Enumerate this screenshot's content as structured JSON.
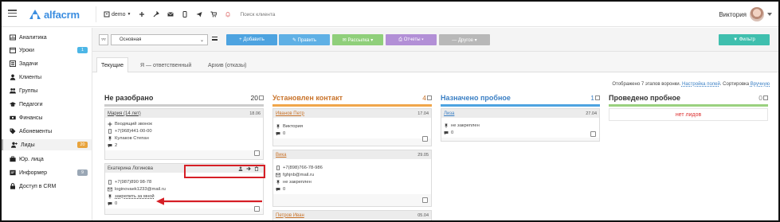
{
  "app": {
    "logo_text": "alfacrm",
    "brand_color": "#3a8de0"
  },
  "topbar": {
    "branch": "demo",
    "search_placeholder": "Поиск клиента",
    "user_name": "Виктория",
    "icons": [
      "plus-icon",
      "wrench-icon",
      "mail-icon",
      "phone-icon",
      "send-icon",
      "cart-icon",
      "bell-icon"
    ]
  },
  "sidebar": {
    "items": [
      {
        "label": "Аналитика",
        "icon": "chart-icon"
      },
      {
        "label": "Уроки",
        "icon": "calendar-icon",
        "badge": "1",
        "badge_color": "#4cb6e6"
      },
      {
        "label": "Задачи",
        "icon": "list-icon"
      },
      {
        "label": "Клиенты",
        "icon": "user-icon"
      },
      {
        "label": "Группы",
        "icon": "users-icon"
      },
      {
        "label": "Педагоги",
        "icon": "graduation-icon"
      },
      {
        "label": "Финансы",
        "icon": "money-icon"
      },
      {
        "label": "Абонементы",
        "icon": "tag-icon"
      },
      {
        "label": "Лиды",
        "icon": "user-plus-icon",
        "badge": "20",
        "badge_color": "#e8a33c",
        "active": true
      },
      {
        "label": "Юр. лица",
        "icon": "briefcase-icon"
      },
      {
        "label": "Информер",
        "icon": "info-icon",
        "badge": "9",
        "badge_color": "#9aa7b5"
      },
      {
        "label": "Доступ в CRM",
        "icon": "lock-icon"
      }
    ]
  },
  "toolbar": {
    "funnel_select": "Основная",
    "add_label": "+ Добавить",
    "edit_label": "✎ Править",
    "mailing_label": "✉ Рассылка ▾",
    "reports_label": "⎙ Отчеты ▾",
    "other_label": "— Другое ▾",
    "filter_label": "▼ Фильтр",
    "colors": {
      "add": "#4da3e0",
      "edit": "#5fb0e5",
      "mailing": "#8fcf7a",
      "reports": "#b28fd6",
      "other": "#b8b8b8",
      "filter": "#3fbfae"
    }
  },
  "tabs": [
    {
      "label": "Текущие",
      "active": true
    },
    {
      "label": "Я — ответственный"
    },
    {
      "label": "Архив (отказы)"
    }
  ],
  "info_bar": {
    "text": "Отображено 7 этапов воронки.",
    "link1": "Настройка полей",
    "text2": ". Сортировка",
    "link2": "Вручную"
  },
  "columns": [
    {
      "title": "Не разобрано",
      "count": "20",
      "title_color": "#333333",
      "line_color": "#cccccc",
      "cards": [
        {
          "name": "Мария (14 лет)",
          "date": "18.06",
          "rows": [
            {
              "icon": "source-icon",
              "text": "Входящий звонок"
            },
            {
              "icon": "phone-icon",
              "text": "+7(968)441-00-00"
            },
            {
              "icon": "pin-icon",
              "text": "Кулаков Степан"
            },
            {
              "icon": "comment-icon",
              "text": "2"
            }
          ]
        },
        {
          "name": "Екатерина Логинова",
          "date": "",
          "actions": [
            "user-icon",
            "arrow-right-icon",
            "trash-icon"
          ],
          "rows": [
            {
              "icon": "phone-icon",
              "text": "+7(987)890 98-78"
            },
            {
              "icon": "mail-icon",
              "text": "loginovaek1233@mail.ru"
            },
            {
              "icon": "pin-icon",
              "text": "закрепить за мной"
            },
            {
              "icon": "comment-icon",
              "text": "0"
            }
          ]
        }
      ]
    },
    {
      "title": "Установлен контакт",
      "count": "4",
      "title_color": "#c9732a",
      "line_color": "#f0a64a",
      "cards": [
        {
          "name": "Иванов Петр",
          "date": "17.04",
          "rows": [
            {
              "icon": "pin-icon",
              "text": "Виктория"
            },
            {
              "icon": "comment-icon",
              "text": "0"
            }
          ]
        },
        {
          "name": "Вика",
          "date": "29.05",
          "rows": [
            {
              "icon": "phone-icon",
              "text": "+7(898)766-78-986"
            },
            {
              "icon": "mail-icon",
              "text": "fghjnb@mail.ru"
            },
            {
              "icon": "pin-icon",
              "text": "не закреплен"
            },
            {
              "icon": "comment-icon",
              "text": "0"
            }
          ]
        },
        {
          "name": "Петров Иван",
          "date": "05.04",
          "rows": []
        }
      ]
    },
    {
      "title": "Назначено пробное",
      "count": "1",
      "title_color": "#3a7fc4",
      "line_color": "#4da3e0",
      "cards": [
        {
          "name": "Лиза",
          "date": "27.04",
          "rows": [
            {
              "icon": "pin-icon",
              "text": "не закреплен"
            },
            {
              "icon": "comment-icon",
              "text": "0"
            }
          ]
        }
      ]
    },
    {
      "title": "Проведено пробное",
      "count": "0",
      "title_color": "#333333",
      "line_color": "#9ad17f",
      "empty_text": "нет лидов",
      "cards": []
    }
  ]
}
